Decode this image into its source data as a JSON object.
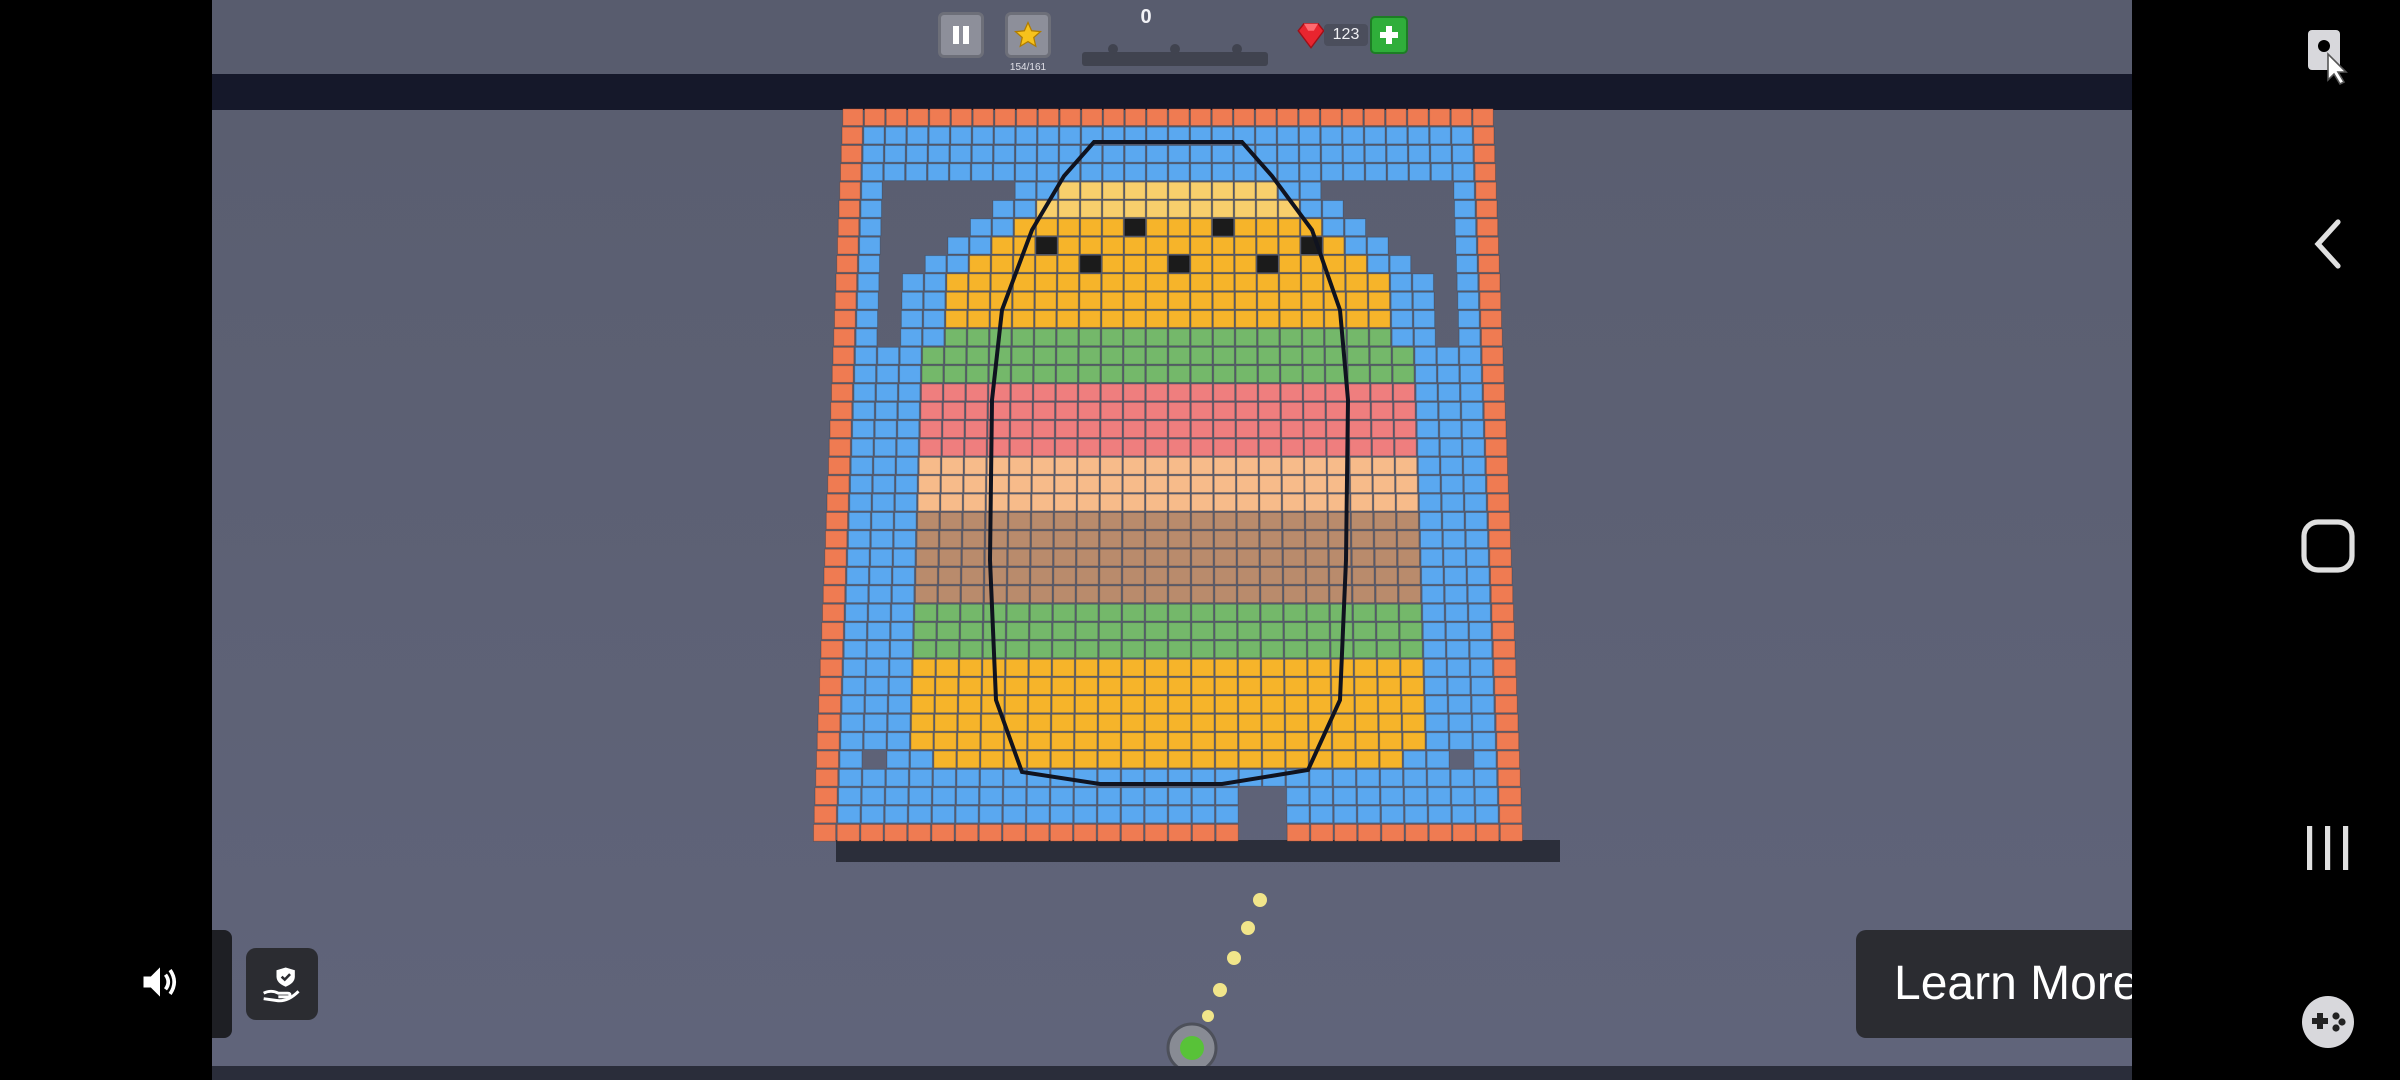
{
  "hud": {
    "score": "0",
    "star_progress": "154/161",
    "gems": "123"
  },
  "ad_overlay": {
    "cta_label": "Learn More"
  },
  "icons": {
    "pause": "pause-icon",
    "star": "star-icon",
    "gem": "gem-icon",
    "plus": "plus-icon",
    "sound": "speaker-icon",
    "privacy": "privacy-hand-icon",
    "nav": [
      "screen-capture-icon",
      "back-icon",
      "home-icon",
      "recents-icon",
      "game-tools-icon"
    ]
  },
  "colors": {
    "frame_orange": "#ef7b52",
    "frame_blue": "#5aa8f0",
    "bun": "#f6b42a",
    "bun_light": "#f8cf6c",
    "lettuce": "#74b86a",
    "tomato": "#ef7e7e",
    "cheese": "#f7bb8a",
    "patty": "#b98b6c",
    "plus_green": "#2fae3a",
    "gem_red": "#e8252f"
  }
}
